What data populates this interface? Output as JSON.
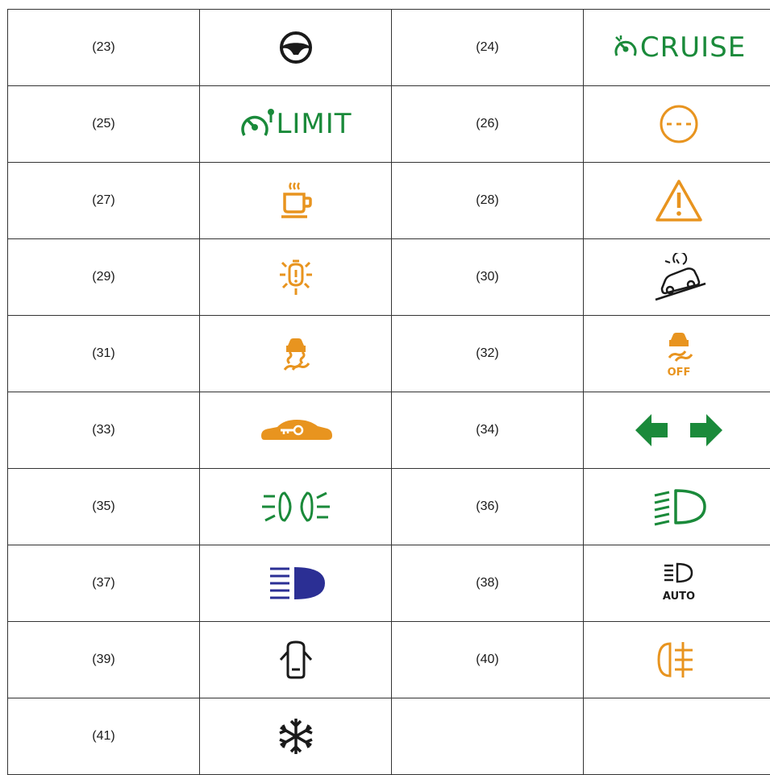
{
  "colors": {
    "green": "#1a8a3a",
    "orange": "#e8941f",
    "blue": "#2b2f94",
    "black": "#1a1a1a"
  },
  "rows": [
    {
      "left": {
        "num": "(23)",
        "icon": "steering-wheel-icon"
      },
      "right": {
        "num": "(24)",
        "icon": "cruise-control-icon",
        "word": "CRUISE"
      }
    },
    {
      "left": {
        "num": "(25)",
        "icon": "speed-limiter-icon",
        "word": "LIMIT"
      },
      "right": {
        "num": "(26)",
        "icon": "speed-limiter-fault-icon"
      }
    },
    {
      "left": {
        "num": "(27)",
        "icon": "coffee-cup-icon"
      },
      "right": {
        "num": "(28)",
        "icon": "warning-triangle-icon"
      }
    },
    {
      "left": {
        "num": "(29)",
        "icon": "bulb-failure-icon"
      },
      "right": {
        "num": "(30)",
        "icon": "hill-descent-icon"
      }
    },
    {
      "left": {
        "num": "(31)",
        "icon": "stability-control-icon"
      },
      "right": {
        "num": "(32)",
        "icon": "stability-control-off-icon",
        "word": "OFF"
      }
    },
    {
      "left": {
        "num": "(33)",
        "icon": "immobilizer-key-icon"
      },
      "right": {
        "num": "(34)",
        "icon": "turn-signals-icon"
      }
    },
    {
      "left": {
        "num": "(35)",
        "icon": "position-lights-icon"
      },
      "right": {
        "num": "(36)",
        "icon": "low-beam-icon"
      }
    },
    {
      "left": {
        "num": "(37)",
        "icon": "high-beam-icon"
      },
      "right": {
        "num": "(38)",
        "icon": "auto-headlights-icon",
        "word": "AUTO"
      }
    },
    {
      "left": {
        "num": "(39)",
        "icon": "door-open-icon"
      },
      "right": {
        "num": "(40)",
        "icon": "rear-fog-light-icon"
      }
    },
    {
      "left": {
        "num": "(41)",
        "icon": "frost-warning-icon"
      }
    }
  ]
}
